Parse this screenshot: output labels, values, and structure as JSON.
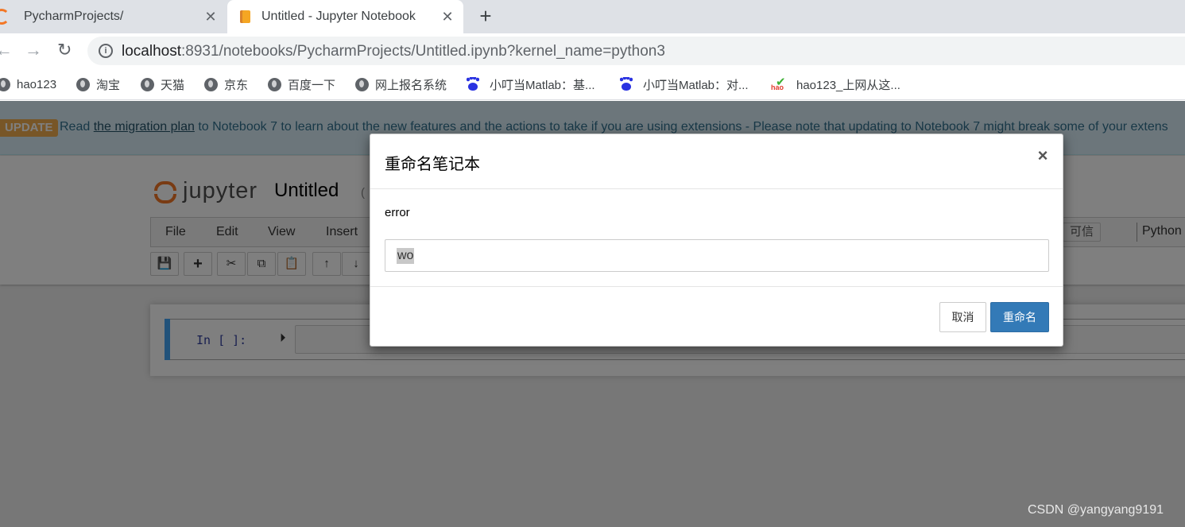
{
  "browser": {
    "tabs": [
      {
        "title": "PycharmProjects/",
        "favicon": "jupyter-icon"
      },
      {
        "title": "Untitled - Jupyter Notebook",
        "favicon": "notebook-icon",
        "active": true
      }
    ],
    "close_glyph": "✕",
    "new_tab_glyph": "+",
    "url_host": "localhost",
    "url_rest": ":8931/notebooks/PycharmProjects/Untitled.ipynb?kernel_name=python3",
    "bookmarks": [
      {
        "label": "hao123",
        "icon": "globe-icon"
      },
      {
        "label": "淘宝",
        "icon": "globe-icon"
      },
      {
        "label": "天猫",
        "icon": "globe-icon"
      },
      {
        "label": "京东",
        "icon": "globe-icon"
      },
      {
        "label": "百度一下",
        "icon": "globe-icon"
      },
      {
        "label": "网上报名系统",
        "icon": "globe-icon"
      },
      {
        "label": "小叮当Matlab：基...",
        "icon": "baidu-paw-icon"
      },
      {
        "label": "小叮当Matlab：对...",
        "icon": "baidu-paw-icon"
      },
      {
        "label": "hao123_上网从这...",
        "icon": "hao123-icon"
      }
    ],
    "hao_icon_text": "hao"
  },
  "banner": {
    "badge": "UPDATE",
    "text_before": "Read ",
    "link": "the migration plan",
    "text_after": " to Notebook 7 to learn about the new features and the actions to take if you are using extensions - Please note that updating to Notebook 7 might break some of your extens"
  },
  "notebook": {
    "logo_text": "jupyter",
    "name": "Untitled",
    "paren_fragment": "(",
    "menu": [
      "File",
      "Edit",
      "View",
      "Insert"
    ],
    "trusted": "可信",
    "kernel": "Python",
    "toolbar_glyphs": [
      "💾",
      "+",
      "✂",
      "⧉",
      "📋",
      "↑",
      "↓"
    ],
    "cell_prompt": "In [ ]:",
    "run_glyph": "⏵"
  },
  "modal": {
    "title": "重命名笔记本",
    "close_glyph": "×",
    "message": "error",
    "input_value": "wo",
    "cancel_label": "取消",
    "rename_label": "重命名"
  },
  "watermark": "CSDN @yangyang9191",
  "colors": {
    "accent": "#337ab7",
    "jupyter_orange": "#f37726",
    "update_badge": "#f0ad4e",
    "cell_selected": "#42a5f5"
  }
}
